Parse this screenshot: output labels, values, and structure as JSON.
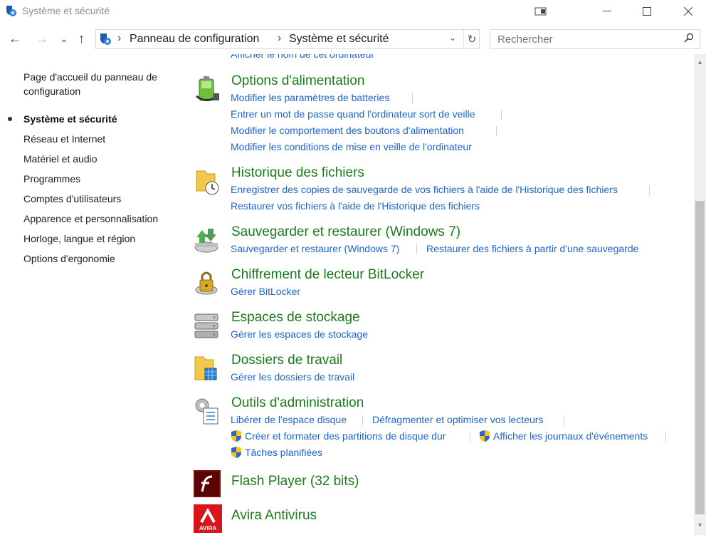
{
  "window": {
    "title": "Système et sécurité"
  },
  "nav": {
    "back": "←",
    "forward": "→",
    "recent": "⌄",
    "up": "↑"
  },
  "address": {
    "crumbs": [
      "Panneau de configuration",
      "Système et sécurité"
    ],
    "separator": "›"
  },
  "search": {
    "placeholder": "Rechercher"
  },
  "partial_link": "Afficher le nom de cet ordinateur",
  "sidebar": {
    "items": [
      "Page d'accueil du panneau de configuration",
      "Système et sécurité",
      "Réseau et Internet",
      "Matériel et audio",
      "Programmes",
      "Comptes d'utilisateurs",
      "Apparence et personnalisation",
      "Horloge, langue et région",
      "Options d'ergonomie"
    ]
  },
  "categories": [
    {
      "title": "Options d'alimentation",
      "icon": "battery-plug-icon",
      "links": [
        "Modifier les paramètres de batteries",
        "Entrer un mot de passe quand l'ordinateur sort de veille",
        "Modifier le comportement des boutons d'alimentation",
        "Modifier les conditions de mise en veille de l'ordinateur"
      ]
    },
    {
      "title": "Historique des fichiers",
      "icon": "folder-clock-icon",
      "links": [
        "Enregistrer des copies de sauvegarde de vos fichiers à l'aide de l'Historique des fichiers",
        "Restaurer vos fichiers à l'aide de l'Historique des fichiers"
      ]
    },
    {
      "title": "Sauvegarder et restaurer (Windows 7)",
      "icon": "backup-drive-icon",
      "links": [
        "Sauvegarder et restaurer (Windows 7)",
        "Restaurer des fichiers à partir d'une sauvegarde"
      ]
    },
    {
      "title": "Chiffrement de lecteur BitLocker",
      "icon": "bitlocker-lock-icon",
      "links": [
        "Gérer BitLocker"
      ]
    },
    {
      "title": "Espaces de stockage",
      "icon": "storage-spaces-icon",
      "links": [
        "Gérer les espaces de stockage"
      ]
    },
    {
      "title": "Dossiers de travail",
      "icon": "work-folders-icon",
      "links": [
        "Gérer les dossiers de travail"
      ]
    },
    {
      "title": "Outils d'administration",
      "icon": "admin-tools-icon",
      "links": [
        "Libérer de l'espace disque",
        "Défragmenter et optimiser vos lecteurs",
        "Créer et formater des partitions de disque dur",
        "Afficher les journaux d'événements",
        "Tâches planifiées"
      ]
    },
    {
      "title": "Flash Player (32 bits)",
      "icon": "flash-player-icon",
      "links": []
    },
    {
      "title": "Avira Antivirus",
      "icon": "avira-icon",
      "icon_text": "AVIRA",
      "links": []
    }
  ],
  "colors": {
    "title_green": "#1e7a1e",
    "link_blue": "#1f64c8"
  }
}
